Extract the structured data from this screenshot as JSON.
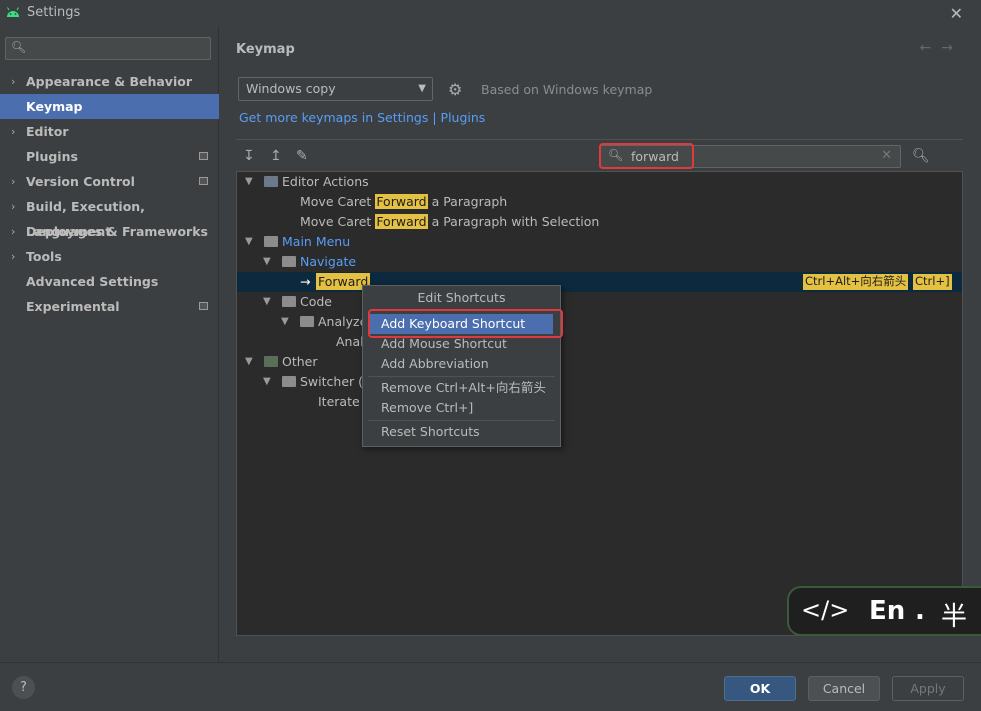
{
  "window": {
    "title": "Settings",
    "close_glyph": "✕"
  },
  "sidebar": {
    "search_placeholder": "",
    "items": [
      {
        "label": "Appearance & Behavior",
        "arrow": "›",
        "badge": false
      },
      {
        "label": "Keymap",
        "arrow": "",
        "badge": false,
        "selected": true
      },
      {
        "label": "Editor",
        "arrow": "›",
        "badge": false
      },
      {
        "label": "Plugins",
        "arrow": "",
        "badge": true
      },
      {
        "label": "Version Control",
        "arrow": "›",
        "badge": true
      },
      {
        "label": "Build, Execution, Deployment",
        "arrow": "›",
        "badge": false
      },
      {
        "label": "Languages & Frameworks",
        "arrow": "›",
        "badge": false
      },
      {
        "label": "Tools",
        "arrow": "›",
        "badge": false
      },
      {
        "label": "Advanced Settings",
        "arrow": "",
        "badge": false
      },
      {
        "label": "Experimental",
        "arrow": "",
        "badge": true
      }
    ]
  },
  "main": {
    "breadcrumb": "Keymap",
    "back_arrow": "←",
    "forward_arrow": "→",
    "keymap_value": "Windows copy",
    "based_on": "Based on Windows keymap",
    "link_text": "Get more keymaps in Settings | Plugins",
    "filter_value": "forward",
    "tree": {
      "editor_actions": "Editor Actions",
      "move_caret_1_prefix": "Move Caret ",
      "move_caret_1_hl": "Forward",
      "move_caret_1_suffix": " a Paragraph",
      "move_caret_2_prefix": "Move Caret ",
      "move_caret_2_hl": "Forward",
      "move_caret_2_suffix": " a Paragraph with Selection",
      "main_menu": "Main Menu",
      "navigate": "Navigate",
      "forward_arrow_glyph": "→",
      "forward": "Forward",
      "shortcut_1": "Ctrl+Alt+向右箭头",
      "shortcut_2": "Ctrl+]",
      "code": "Code",
      "analyze": "Analyze",
      "analyze_child": "Analy",
      "other": "Other",
      "switcher": "Switcher (R",
      "iterate": "Iterate S"
    }
  },
  "popup": {
    "title": "Edit Shortcuts",
    "items": [
      "Add Keyboard Shortcut",
      "Add Mouse Shortcut",
      "Add Abbreviation",
      "Remove Ctrl+Alt+向右箭头",
      "Remove Ctrl+]",
      "Reset Shortcuts"
    ]
  },
  "ime": {
    "code_glyph": "</>",
    "lang": "En",
    "dot": ".",
    "width_mode": "半"
  },
  "footer": {
    "help": "?",
    "ok": "OK",
    "cancel": "Cancel",
    "apply": "Apply"
  },
  "colors": {
    "accent_selection": "#4b6eaf",
    "highlight_match": "#e4c143",
    "annotation_red": "#e0393e",
    "link": "#589df6"
  }
}
